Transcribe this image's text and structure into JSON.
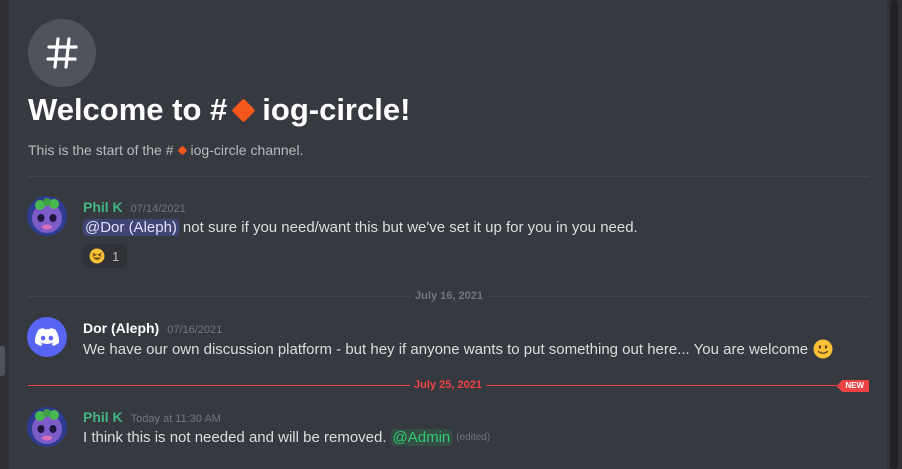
{
  "channel": {
    "welcome_prefix": "Welcome to #",
    "name": "iog-circle",
    "welcome_suffix": "!",
    "sub_prefix": "This is the start of the #",
    "sub_suffix": "channel."
  },
  "messages": [
    {
      "author": "Phil K",
      "author_color": "#43b581",
      "timestamp": "07/14/2021",
      "mention": "@Dor (Aleph)",
      "text": "not sure if you need/want this but we've set  it up for you in you need.",
      "reaction": {
        "emoji": "grinning-squinting-face",
        "count": "1"
      }
    },
    {
      "author": "Dor (Aleph)",
      "author_color": "#ffffff",
      "timestamp": "07/16/2021",
      "text": "We have our own discussion platform - but hey if anyone wants to put something out here... You are welcome",
      "emoji": "slightly-smiling-face"
    },
    {
      "author": "Phil K",
      "author_color": "#43b581",
      "timestamp": "Today at 11:30 AM",
      "text": "I think this is not needed and will be removed.",
      "mention": "@Admin",
      "edited": "(edited)"
    }
  ],
  "dividers": [
    {
      "label": "July 16, 2021",
      "color": "#72767d"
    },
    {
      "label": "July 25, 2021",
      "color": "#ed4245",
      "badge": "NEW"
    }
  ],
  "colors": {
    "background": "#36393f",
    "accent_new": "#ed4245",
    "channel_icon": "#f4561c"
  }
}
